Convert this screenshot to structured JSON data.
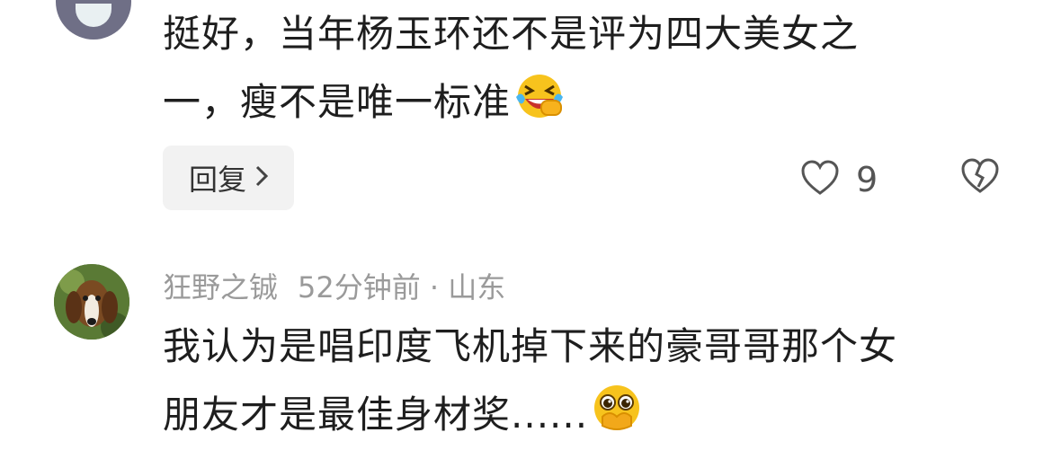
{
  "comment_1": {
    "text_line1": "挺好，当年杨玉环还不是评为四大美女之",
    "text_line2": "一，瘦不是唯一标准",
    "emoji": "laughing-crying-emoji",
    "reply_label": "回复",
    "like_count": "9"
  },
  "comment_2": {
    "username": "狂野之铖",
    "time": "52分钟前",
    "separator": "·",
    "location": "山东",
    "text_line1": "我认为是唱印度飞机掉下来的豪哥哥那个女",
    "text_line2": "朋友才是最佳身材奖......",
    "emoji": "pleading-face-emoji"
  },
  "colors": {
    "text": "#1e1e1e",
    "meta": "#9a9a9a",
    "reply_bg": "#f2f2f2",
    "icon": "#555555"
  }
}
